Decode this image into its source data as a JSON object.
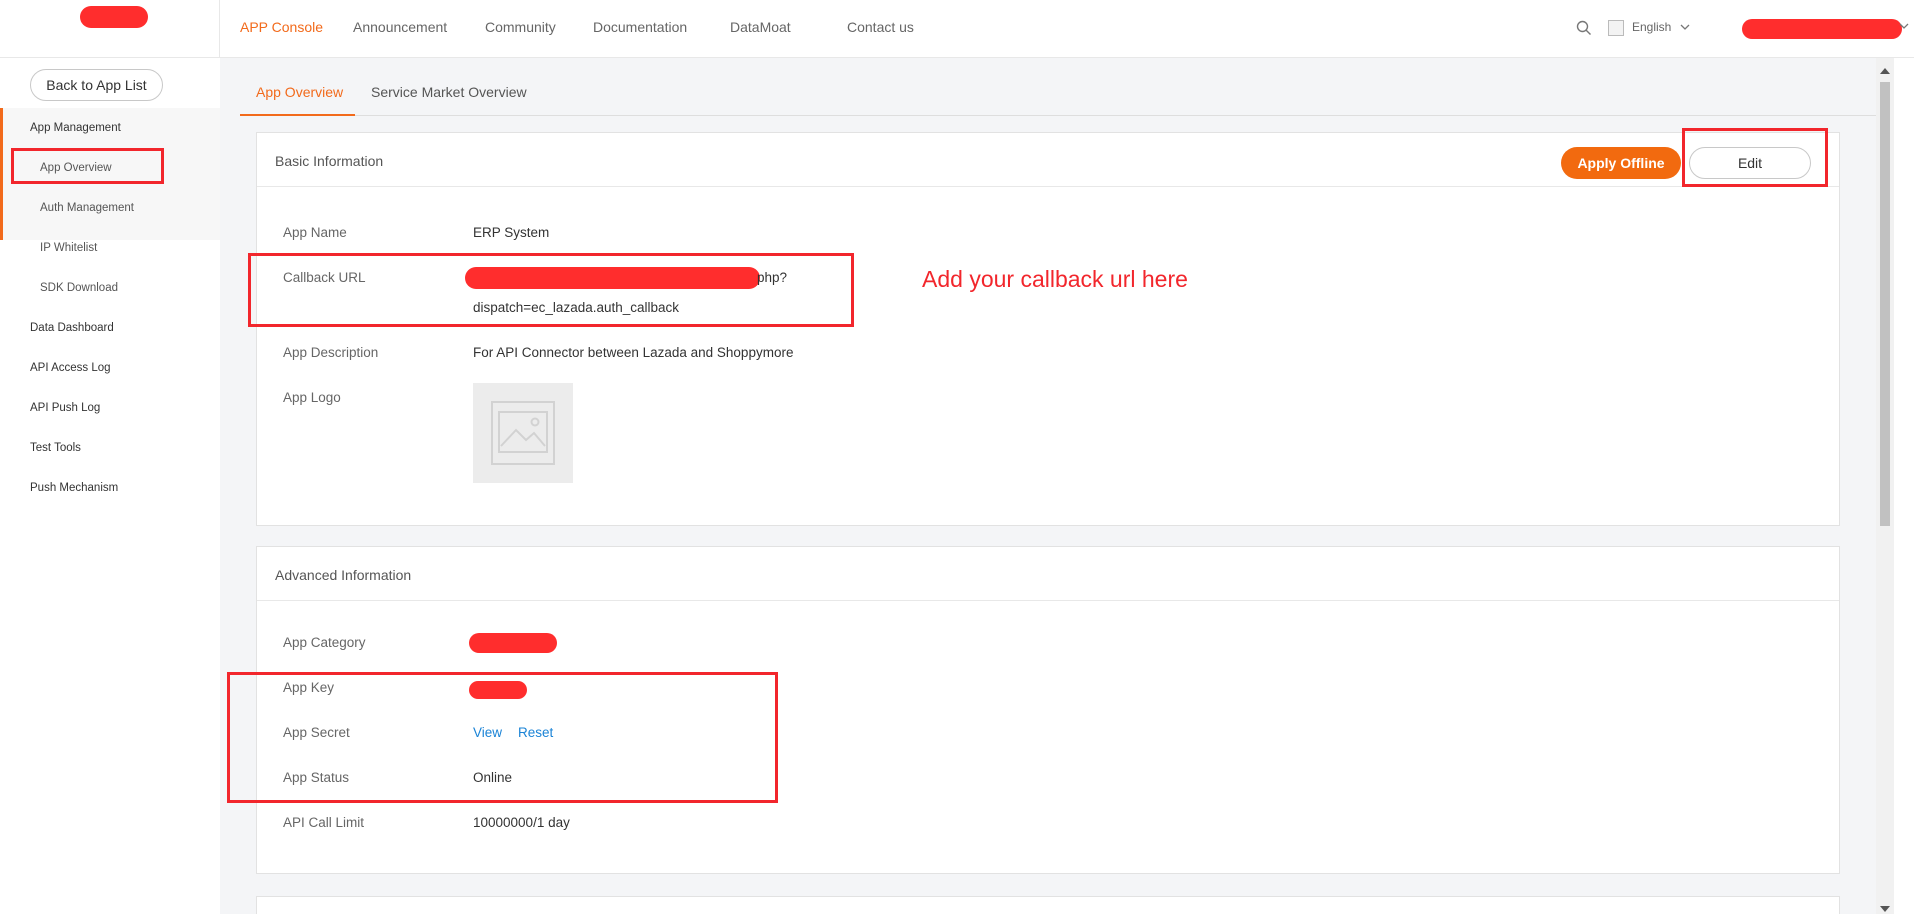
{
  "nav": {
    "items": [
      {
        "label": "APP Console",
        "active": true
      },
      {
        "label": "Announcement"
      },
      {
        "label": "Community"
      },
      {
        "label": "Documentation"
      },
      {
        "label": "DataMoat"
      },
      {
        "label": "Contact us"
      }
    ],
    "language": "English",
    "icons": {
      "search": "search-icon",
      "chevron": "chevron-down-icon"
    },
    "accent_color": "#f26a1b"
  },
  "sidebar": {
    "back_label": "Back to App List",
    "items": [
      {
        "label": "App Management"
      },
      {
        "label": "App Overview"
      },
      {
        "label": "Auth Management"
      },
      {
        "label": "IP Whitelist"
      },
      {
        "label": "SDK Download"
      },
      {
        "label": "Data Dashboard"
      },
      {
        "label": "API Access Log"
      },
      {
        "label": "API Push Log"
      },
      {
        "label": "Test Tools"
      },
      {
        "label": "Push Mechanism"
      }
    ]
  },
  "tabs": [
    {
      "label": "App Overview",
      "active": true
    },
    {
      "label": "Service Market Overview"
    }
  ],
  "basic": {
    "title": "Basic Information",
    "apply_offline": "Apply Offline",
    "edit": "Edit",
    "app_name_label": "App Name",
    "app_name": "ERP System",
    "callback_label": "Callback URL",
    "callback_tail": "php?",
    "callback_line2": "dispatch=ec_lazada.auth_callback",
    "description_label": "App Description",
    "description": "For API Connector between Lazada and Shoppymore",
    "logo_label": "App Logo"
  },
  "annotation": "Add your callback url here",
  "advanced": {
    "title": "Advanced Information",
    "category_label": "App Category",
    "key_label": "App Key",
    "secret_label": "App Secret",
    "secret_view": "View",
    "secret_reset": "Reset",
    "status_label": "App Status",
    "status": "Online",
    "limit_label": "API Call Limit",
    "limit": "10000000/1 day"
  },
  "colors": {
    "redaction": "#ff2d2d",
    "highlight": "#f2262c",
    "primary_button": "#f26a0f",
    "link": "#1a83d6"
  }
}
